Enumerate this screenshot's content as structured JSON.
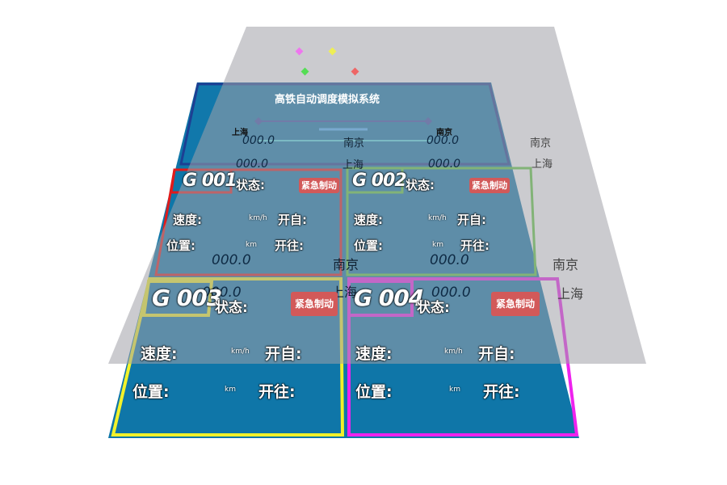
{
  "title": "高铁自动调度模拟系统",
  "route": {
    "left_station": "上海",
    "right_station": "南京",
    "display_upper": {
      "left_value": "000.0",
      "center_city": "南京",
      "right_value": "000.0"
    },
    "display_lower": {
      "left_value": "000.0",
      "center_city": "上海",
      "right_value": "000.0"
    }
  },
  "overlay": {
    "side_cities_top": [
      "南京",
      "上海"
    ],
    "side_cities_bottom": [
      "南京",
      "上海"
    ],
    "middle_value_left": "000.0",
    "middle_city_upper": "南京",
    "middle_value_right": "000.0",
    "middle_city_lower": "上海",
    "lower_value_left": "000.0",
    "lower_value_right": "000.0",
    "dot_colors": [
      "#ee77ee",
      "#eeee55",
      "#55dd55",
      "#ee6666"
    ]
  },
  "trains": [
    {
      "id": "G 001",
      "status_label": "状态:",
      "emergency_label": "紧急制动",
      "speed_label": "速度:",
      "speed_unit": "km/h",
      "from_label": "开自:",
      "position_label": "位置:",
      "position_unit": "km",
      "to_label": "开往:",
      "border_color": "#e01b1b"
    },
    {
      "id": "G 002",
      "status_label": "状态:",
      "emergency_label": "紧急制动",
      "speed_label": "速度:",
      "speed_unit": "km/h",
      "from_label": "开自:",
      "position_label": "位置:",
      "position_unit": "km",
      "to_label": "开往:",
      "border_color": "#5ecb3c"
    },
    {
      "id": "G 003",
      "status_label": "状态:",
      "emergency_label": "紧急制动",
      "speed_label": "速度:",
      "speed_unit": "km/h",
      "from_label": "开自:",
      "position_label": "位置:",
      "position_unit": "km",
      "to_label": "开往:",
      "border_color": "#f2f22a"
    },
    {
      "id": "G 004",
      "status_label": "状态:",
      "emergency_label": "紧急制动",
      "speed_label": "速度:",
      "speed_unit": "km/h",
      "from_label": "开自:",
      "position_label": "位置:",
      "position_unit": "km",
      "to_label": "开往:",
      "border_color": "#ee22ee"
    }
  ]
}
